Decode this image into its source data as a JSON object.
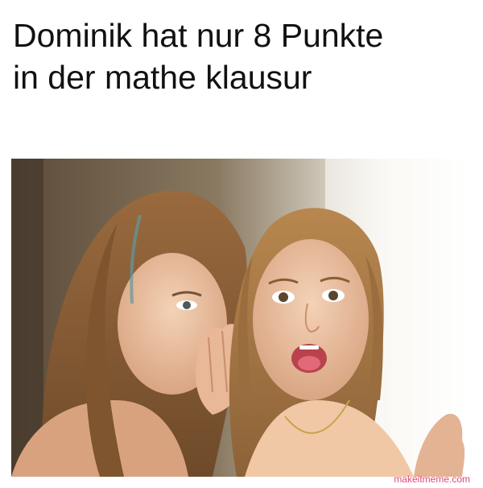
{
  "meme": {
    "caption_line1": "Dominik hat nur 8 Punkte",
    "caption_line2": "in der mathe klausur",
    "watermark": "makeitmeme.com"
  },
  "colors": {
    "caption_text": "#111111",
    "watermark_text": "#e3457a",
    "background": "#ffffff"
  }
}
